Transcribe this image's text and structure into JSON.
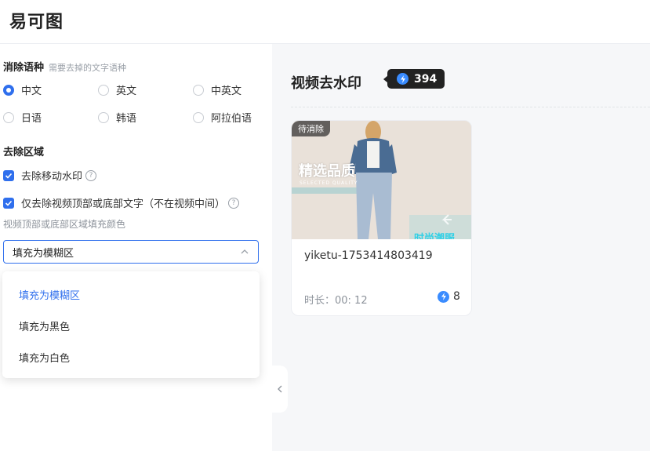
{
  "app": {
    "logo": "易可图"
  },
  "language": {
    "title": "消除语种",
    "hint": "需要去掉的文字语种",
    "options": [
      {
        "label": "中文",
        "checked": true
      },
      {
        "label": "英文",
        "checked": false
      },
      {
        "label": "中英文",
        "checked": false
      },
      {
        "label": "日语",
        "checked": false
      },
      {
        "label": "韩语",
        "checked": false
      },
      {
        "label": "阿拉伯语",
        "checked": false
      }
    ]
  },
  "area": {
    "title": "去除区域",
    "options": [
      {
        "label": "去除移动水印",
        "checked": true
      },
      {
        "label": "仅去除视频顶部或底部文字（不在视频中间）",
        "checked": true
      }
    ],
    "fill_label": "视频顶部或底部区域填充颜色",
    "fill_value": "填充为模糊区",
    "fill_options": [
      "填充为模糊区",
      "填充为黑色",
      "填充为白色"
    ]
  },
  "main": {
    "title": "视频去水印",
    "credits": "394",
    "card": {
      "status": "待消除",
      "watermark_text": "精选品质",
      "watermark_subtext": "SELECTED QUALITY",
      "watermark_bottom": "时尚潮服",
      "name": "yiketu-1753414803419",
      "duration": "时长：00: 12",
      "cost": "8"
    }
  },
  "colors": {
    "accent": "#2f6fed",
    "badge_bg": "#222222",
    "bolt": "#3a8cff",
    "panel_bg": "#f6f7f9"
  }
}
